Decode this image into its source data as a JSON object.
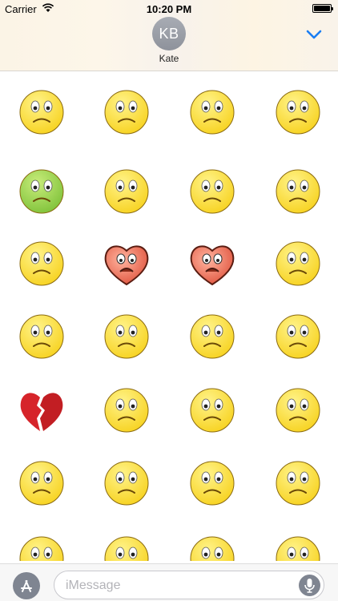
{
  "status_bar": {
    "carrier": "Carrier",
    "time": "10:20 PM"
  },
  "header": {
    "avatar_initials": "KB",
    "contact_name": "Kate",
    "accent_color": "#1a7ef2"
  },
  "stickers": [
    {
      "name": "thumbs-down-worried-emoji-icon",
      "kind": "face"
    },
    {
      "name": "worried-emoji-icon",
      "kind": "face"
    },
    {
      "name": "crying-grimace-emoji-icon",
      "kind": "face"
    },
    {
      "name": "cracked-face-emoji-icon",
      "kind": "face"
    },
    {
      "name": "sick-green-emoji-icon",
      "kind": "face"
    },
    {
      "name": "crying-puddle-emoji-icon",
      "kind": "face"
    },
    {
      "name": "sad-emoji-icon",
      "kind": "face"
    },
    {
      "name": "nervous-wavy-mouth-emoji-icon",
      "kind": "face"
    },
    {
      "name": "thumbs-down-blue-eyes-emoji-icon",
      "kind": "face"
    },
    {
      "name": "heart-tongue-out-icon",
      "kind": "heart"
    },
    {
      "name": "heart-crying-icon",
      "kind": "heart"
    },
    {
      "name": "disgusted-tongue-emoji-icon",
      "kind": "face"
    },
    {
      "name": "teary-frown-emoji-icon",
      "kind": "face"
    },
    {
      "name": "eye-roll-emoji-icon",
      "kind": "face"
    },
    {
      "name": "sad-smile-emoji-icon",
      "kind": "face"
    },
    {
      "name": "eye-roll-frown-emoji-icon",
      "kind": "face"
    },
    {
      "name": "broken-heart-icon",
      "kind": "broken-heart"
    },
    {
      "name": "crying-closed-eyes-emoji-icon",
      "kind": "face"
    },
    {
      "name": "sad-brows-emoji-icon",
      "kind": "face"
    },
    {
      "name": "tongue-out-emoji-icon",
      "kind": "face"
    },
    {
      "name": "red-eyed-emoji-icon",
      "kind": "face"
    },
    {
      "name": "frustrated-emoji-icon",
      "kind": "face"
    },
    {
      "name": "wink-thumbs-up-emoji-icon",
      "kind": "face"
    },
    {
      "name": "big-grin-emoji-icon",
      "kind": "face"
    },
    {
      "name": "wide-eyed-emoji-icon",
      "kind": "face"
    },
    {
      "name": "squint-emoji-icon",
      "kind": "face"
    },
    {
      "name": "wide-eyed-emoji-icon",
      "kind": "face"
    },
    {
      "name": "squint-emoji-icon",
      "kind": "face"
    }
  ],
  "input_bar": {
    "placeholder": "iMessage"
  }
}
